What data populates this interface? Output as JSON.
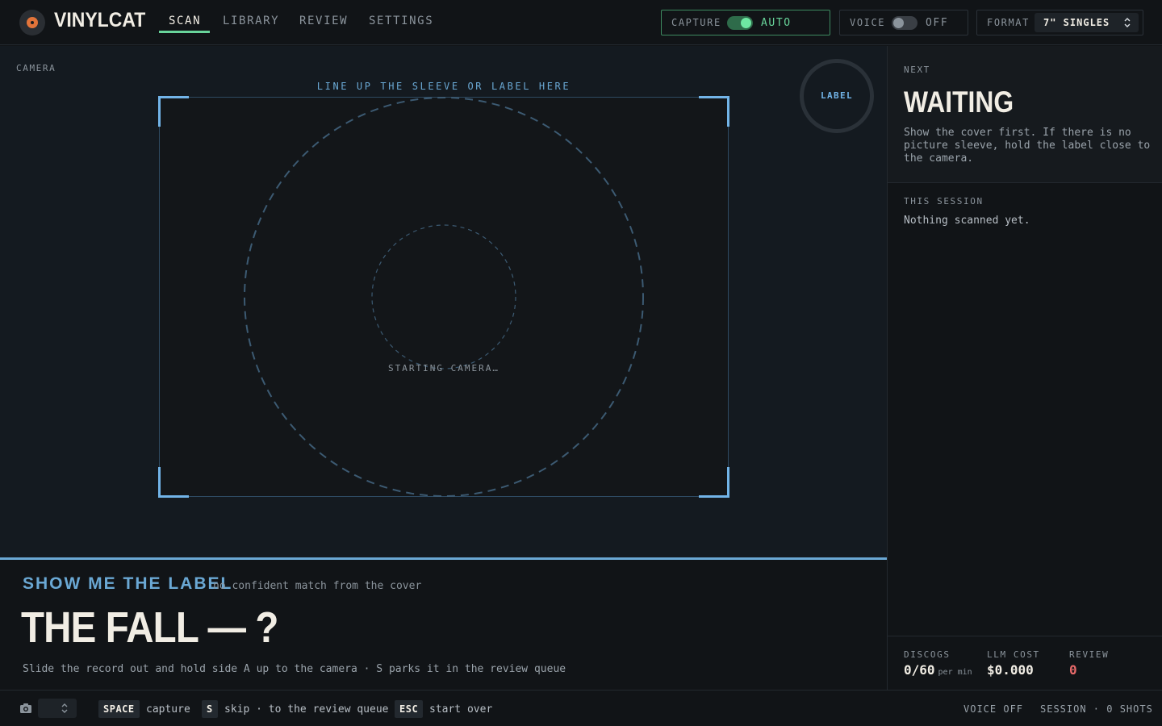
{
  "app": {
    "name": "VINYLCAT",
    "logo_icon": "vinyl-record-icon"
  },
  "nav": {
    "tabs": [
      {
        "label": "SCAN",
        "active": true
      },
      {
        "label": "LIBRARY",
        "active": false
      },
      {
        "label": "REVIEW",
        "active": false
      },
      {
        "label": "SETTINGS",
        "active": false
      }
    ]
  },
  "controls": {
    "capture": {
      "label": "CAPTURE",
      "value": "AUTO",
      "on": true
    },
    "voice": {
      "label": "VOICE",
      "value": "OFF",
      "on": false
    },
    "format": {
      "label": "FORMAT",
      "selected": "7\" SINGLES"
    }
  },
  "camera": {
    "label": "CAMERA",
    "guide": "LINE UP THE SLEEVE OR LABEL HERE",
    "status": "STARTING CAMERA…",
    "badge": "LABEL"
  },
  "prompt": {
    "heading": "SHOW ME THE LABEL",
    "subheading": "no confident match from the cover",
    "title": "THE FALL — ?",
    "hint": "Slide the record out and hold side A up to the camera · S parks it in the review queue"
  },
  "panel": {
    "next_label": "NEXT",
    "status": "WAITING",
    "description": "Show the cover first. If there is no picture sleeve, hold the label close to the camera.",
    "session_label": "THIS SESSION",
    "session_empty": "Nothing scanned yet.",
    "stats": {
      "discogs_label": "DISCOGS",
      "discogs_value": "0/60",
      "discogs_unit": "per min",
      "llm_label": "LLM COST",
      "llm_value": "$0.000",
      "review_label": "REVIEW",
      "review_value": "0"
    }
  },
  "footer": {
    "keys": [
      {
        "key": "SPACE",
        "desc": "capture"
      },
      {
        "key": "S",
        "desc": "skip · to the review queue"
      },
      {
        "key": "ESC",
        "desc": "start over"
      }
    ],
    "voice_status": "VOICE OFF",
    "session_status": "SESSION · 0 SHOTS"
  },
  "colors": {
    "accent_green": "#68d49a",
    "accent_blue": "#6aa8d4",
    "record_orange": "#e2743a",
    "review_red": "#e86a6a"
  }
}
